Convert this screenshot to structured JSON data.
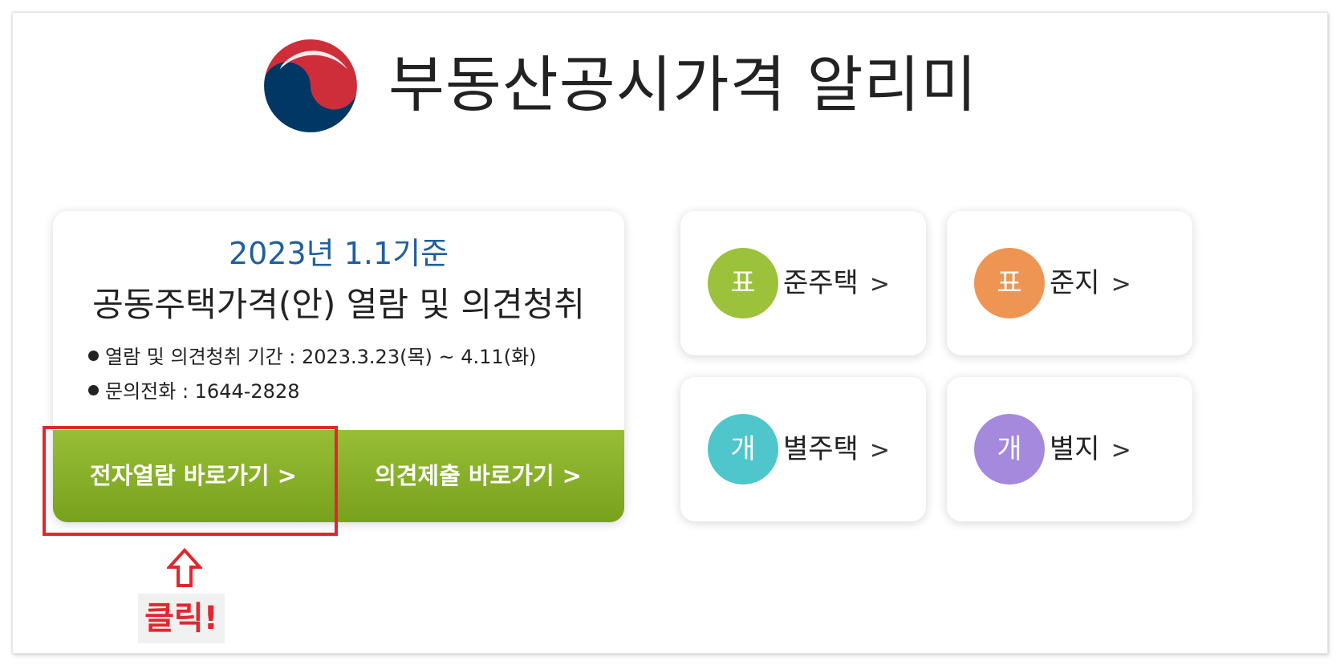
{
  "header": {
    "site_title": "부동산공시가격 알리미"
  },
  "notice_card": {
    "date_line": "2023년 1.1기준",
    "title": "공동주택가격(안) 열람 및 의견청취",
    "info": [
      "열람 및 의견청취 기간 : 2023.3.23(목) ~ 4.11(화)",
      "문의전화 : 1644-2828"
    ],
    "buttons": {
      "view_label": "전자열람 바로가기 >",
      "submit_label": "의견제출 바로가기 >"
    }
  },
  "tiles": [
    {
      "badge": "표",
      "label": "준주택",
      "chevron": ">",
      "color": "#9cc13b"
    },
    {
      "badge": "표",
      "label": "준지",
      "chevron": ">",
      "color": "#ee9553"
    },
    {
      "badge": "개",
      "label": "별주택",
      "chevron": ">",
      "color": "#4ec6cc"
    },
    {
      "badge": "개",
      "label": "별지",
      "chevron": ">",
      "color": "#a489dd"
    }
  ],
  "annotation": {
    "click_text": "클릭!",
    "accent_color": "#e3262e",
    "arrow_icon": "up-arrow-icon"
  },
  "colors": {
    "brand_blue": "#1f5fa0",
    "action_green": "#86ad27"
  },
  "icons": {
    "emblem": "korea-government-emblem-icon"
  }
}
